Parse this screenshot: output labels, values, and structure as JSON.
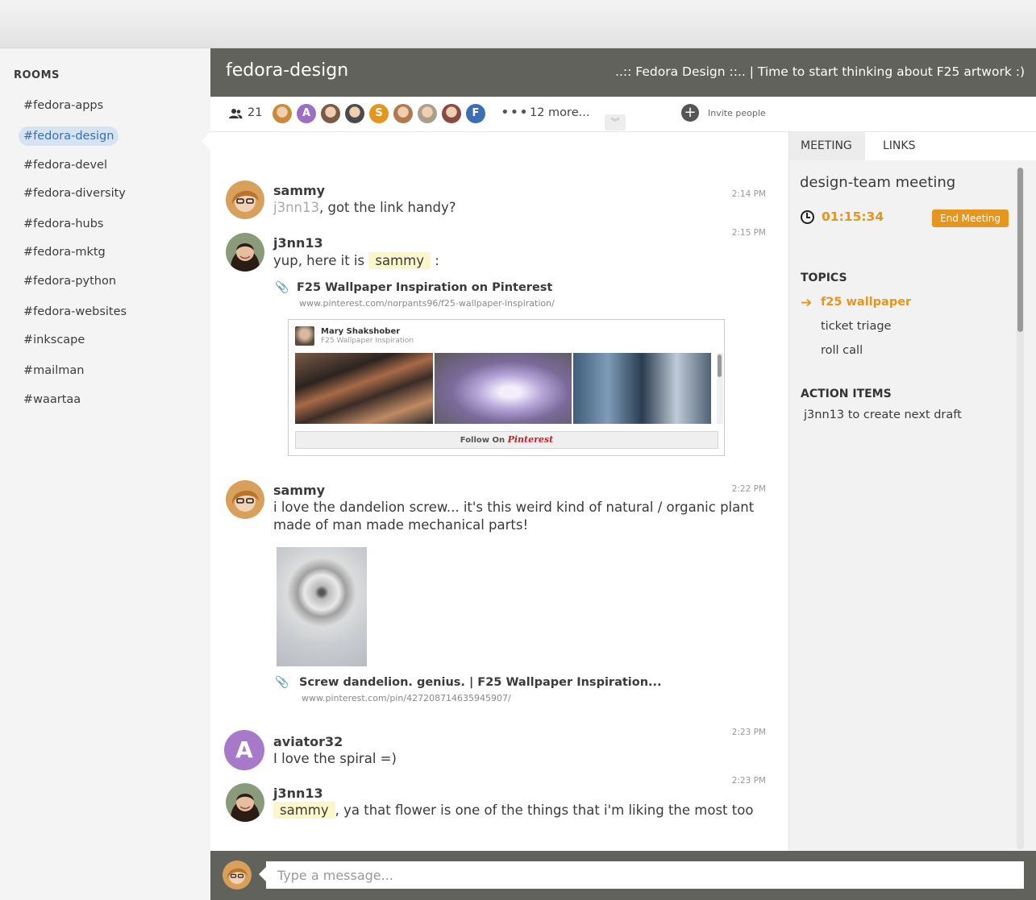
{
  "sidebar": {
    "heading": "ROOMS",
    "rooms": [
      {
        "label": "#fedora-apps",
        "active": false
      },
      {
        "label": "#fedora-design",
        "active": true
      },
      {
        "label": "#fedora-devel",
        "active": false
      },
      {
        "label": "#fedora-diversity",
        "active": false
      },
      {
        "label": "#fedora-hubs",
        "active": false
      },
      {
        "label": "#fedora-mktg",
        "active": false
      },
      {
        "label": "#fedora-python",
        "active": false
      },
      {
        "label": "#fedora-websites",
        "active": false
      },
      {
        "label": "#inkscape",
        "active": false
      },
      {
        "label": "#mailman",
        "active": false
      },
      {
        "label": "#waartaa",
        "active": false
      }
    ]
  },
  "header": {
    "title": "fedora-design",
    "topic": "..:: Fedora Design ::.. | Time to start thinking about F25 artwork :)"
  },
  "members": {
    "count": "21",
    "avatars": [
      {
        "letter": "",
        "color": "#c98a3c"
      },
      {
        "letter": "A",
        "color": "#9b6fc4"
      },
      {
        "letter": "",
        "color": "#7a5a44"
      },
      {
        "letter": "",
        "color": "#4a4a4a"
      },
      {
        "letter": "S",
        "color": "#e5961f"
      },
      {
        "letter": "",
        "color": "#b07a50"
      },
      {
        "letter": "",
        "color": "#a8a08a"
      },
      {
        "letter": "",
        "color": "#8a4a44"
      },
      {
        "letter": "F",
        "color": "#3c6eb4"
      }
    ],
    "more_dots": "•••",
    "more_label": "12 more...",
    "expand_glyph": "︾",
    "invite_label": "Invite people"
  },
  "messages": [
    {
      "user": "sammy",
      "time": "2:14 PM",
      "mention": "j3nn13",
      "text": ", got the link handy?"
    },
    {
      "user": "j3nn13",
      "time": "2:15 PM",
      "text_before": "yup, here it is ",
      "mention": "sammy",
      "text_after": " :",
      "link": {
        "title": "F25 Wallpaper Inspiration on Pinterest",
        "url": "www.pinterest.com/norpants96/f25-wallpaper-inspiration/"
      },
      "pin": {
        "name": "Mary Shakshober",
        "board": "F25 Wallpaper Inspiration",
        "follow_prefix": "Follow On ",
        "follow_brand": "Pinterest"
      }
    },
    {
      "user": "sammy",
      "time": "2:22 PM",
      "line1": "i love the dandelion screw... it's this weird kind of natural / organic plant",
      "line2": "made of man made mechanical parts!",
      "link": {
        "title": "Screw dandelion. genius. | F25 Wallpaper Inspiration...",
        "url": "www.pinterest.com/pin/427208714635945907/"
      }
    },
    {
      "user": "aviator32",
      "avatar_letter": "A",
      "time": "2:23 PM",
      "text": "I love the spiral =)"
    },
    {
      "user": "j3nn13",
      "time": "2:23 PM",
      "mention": "sammy",
      "text": ", ya that flower is one of the things that i'm liking the most too"
    }
  ],
  "panel": {
    "tabs": [
      "MEETING",
      "LINKS"
    ],
    "meeting_title": "design-team meeting",
    "timer": "01:15:34",
    "end_button": "End Meeting",
    "topics_heading": "TOPICS",
    "topics": [
      "f25 wallpaper",
      "ticket triage",
      "roll call"
    ],
    "current_topic_arrow": "➔",
    "action_heading": "ACTION ITEMS",
    "action_items": [
      "j3nn13 to create next draft"
    ]
  },
  "composer": {
    "placeholder": "Type a message..."
  },
  "colors": {
    "accent": "#e5961f",
    "active_room": "#3c6eb4",
    "header_bg": "#62625c",
    "mention_hl": "#fbf7c9"
  },
  "icons": {
    "people": "people-icon",
    "invite": "plus-circle-icon",
    "attachment": "paperclip-icon",
    "clock": "clock-icon",
    "arrow": "arrow-right-icon"
  }
}
